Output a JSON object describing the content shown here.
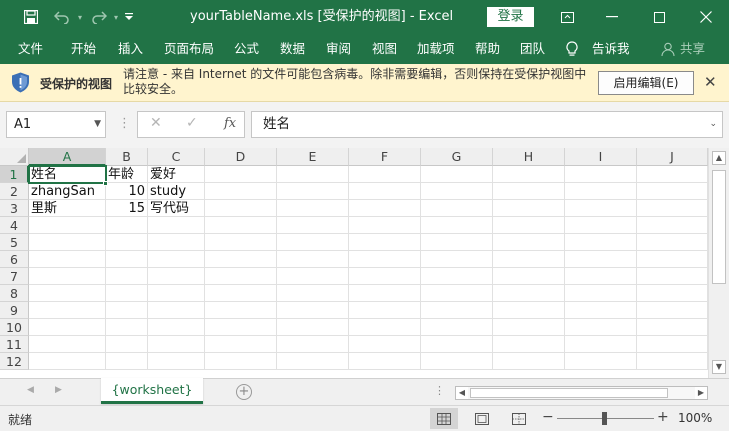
{
  "window": {
    "title": "yourTableName.xls  [受保护的视图]  -  Excel",
    "login_label": "登录"
  },
  "ribbon": {
    "tabs": [
      "文件",
      "开始",
      "插入",
      "页面布局",
      "公式",
      "数据",
      "审阅",
      "视图",
      "加载项",
      "帮助",
      "团队"
    ],
    "tell_me": "告诉我",
    "share": "共享"
  },
  "protected_view": {
    "title": "受保护的视图",
    "message": "请注意 - 来自 Internet 的文件可能包含病毒。除非需要编辑，否则保持在受保护视图中比较安全。",
    "enable_button": "启用编辑(E)",
    "close_glyph": "✕"
  },
  "formula_bar": {
    "name_box": "A1",
    "fx_label": "fx",
    "content": "姓名"
  },
  "sheet": {
    "columns": [
      "A",
      "B",
      "C",
      "D",
      "E",
      "F",
      "G",
      "H",
      "I",
      "J"
    ],
    "rows": [
      "1",
      "2",
      "3",
      "4",
      "5",
      "6",
      "7",
      "8",
      "9",
      "10",
      "11",
      "12"
    ],
    "cells": [
      [
        "姓名",
        "年龄",
        "爱好"
      ],
      [
        "zhangSan",
        "10",
        "study"
      ],
      [
        "里斯",
        "15",
        "写代码"
      ]
    ],
    "selected_cell": "A1",
    "tab_name": "{worksheet}"
  },
  "status_bar": {
    "status": "就绪",
    "zoom": "100%",
    "zoom_minus": "−",
    "zoom_plus": "+"
  },
  "colors": {
    "brand": "#217346",
    "protected_bar": "#fff4ce"
  }
}
